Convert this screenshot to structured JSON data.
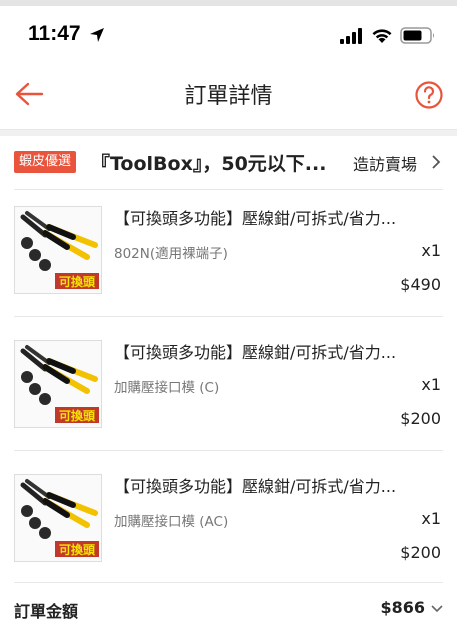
{
  "status": {
    "time": "11:47"
  },
  "nav": {
    "title": "訂單詳情"
  },
  "shop": {
    "badge": "蝦皮優選",
    "name": "『ToolBox』，50元以下...",
    "visit_label": "造訪賣場"
  },
  "thumbnail_text": "可換頭",
  "items": [
    {
      "title": "【可換頭多功能】壓線鉗/可拆式/省力...",
      "variant": "802N(適用裸端子)",
      "qty": "x1",
      "price": "$490"
    },
    {
      "title": "【可換頭多功能】壓線鉗/可拆式/省力...",
      "variant": "加購壓接口模 (C)",
      "qty": "x1",
      "price": "$200"
    },
    {
      "title": "【可換頭多功能】壓線鉗/可拆式/省力...",
      "variant": "加購壓接口模 (AC)",
      "qty": "x1",
      "price": "$200"
    }
  ],
  "total": {
    "label": "訂單金額",
    "value": "$866"
  },
  "colors": {
    "accent": "#e8543c",
    "tool_yellow": "#f2c200",
    "thumb_text": "#f5e400"
  },
  "icons": [
    "location-arrow-icon",
    "cellular-signal-icon",
    "wifi-icon",
    "battery-icon",
    "back-arrow-icon",
    "help-icon",
    "chevron-right-icon",
    "chevron-down-icon"
  ]
}
